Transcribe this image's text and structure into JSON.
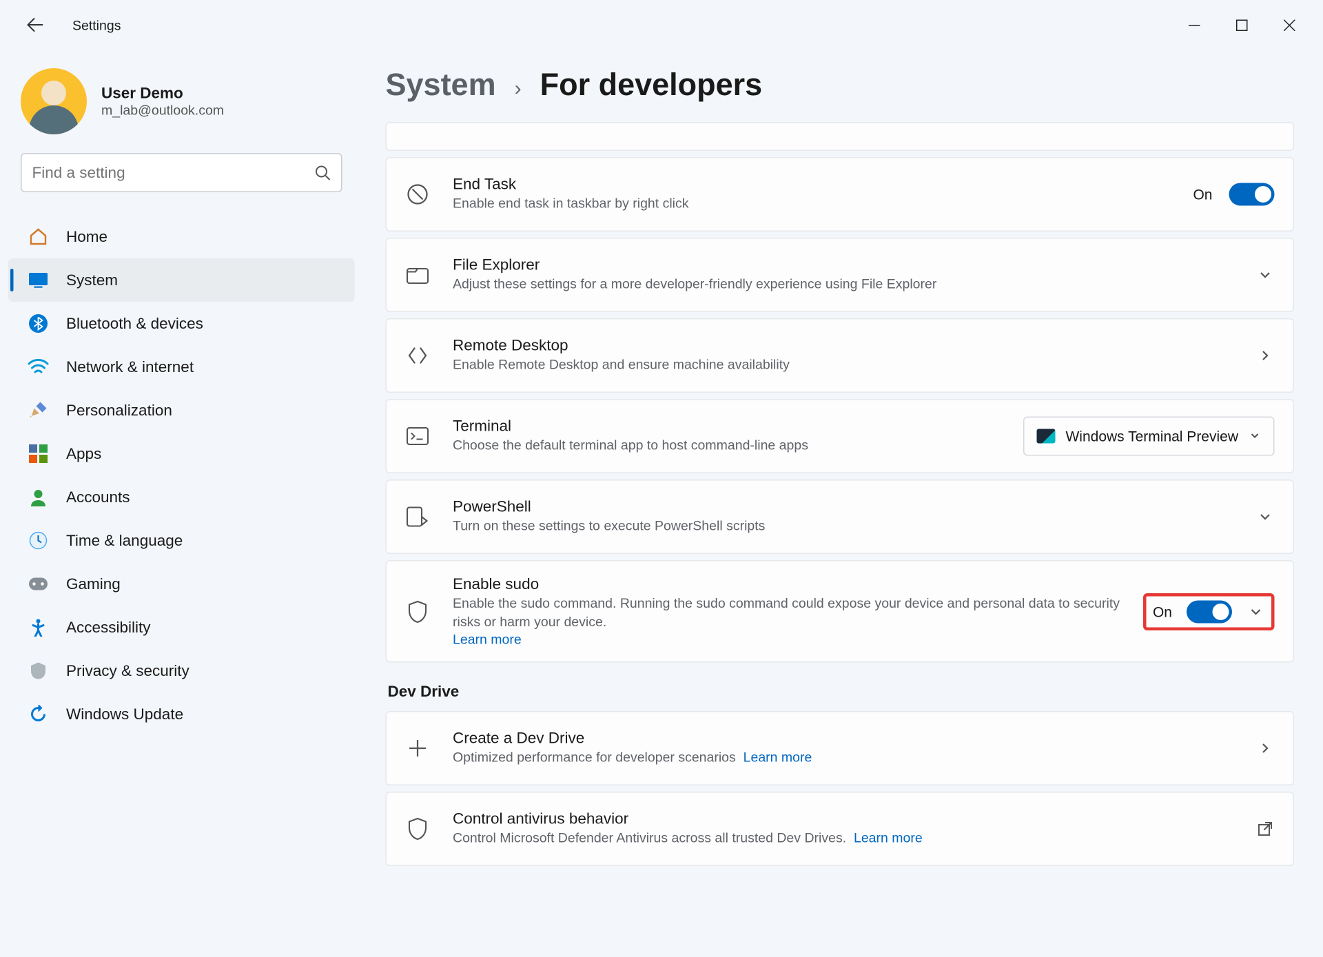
{
  "app": {
    "title": "Settings"
  },
  "user": {
    "name": "User Demo",
    "email": "m_lab@outlook.com"
  },
  "search": {
    "placeholder": "Find a setting"
  },
  "nav": {
    "home": "Home",
    "system": "System",
    "bluetooth": "Bluetooth & devices",
    "network": "Network & internet",
    "personalization": "Personalization",
    "apps": "Apps",
    "accounts": "Accounts",
    "time": "Time & language",
    "gaming": "Gaming",
    "accessibility": "Accessibility",
    "privacy": "Privacy & security",
    "update": "Windows Update"
  },
  "crumb": {
    "parent": "System",
    "sep": "›",
    "current": "For developers"
  },
  "cards": {
    "endTask": {
      "title": "End Task",
      "sub": "Enable end task in taskbar by right click",
      "state": "On"
    },
    "fileExplorer": {
      "title": "File Explorer",
      "sub": "Adjust these settings for a more developer-friendly experience using File Explorer"
    },
    "remoteDesktop": {
      "title": "Remote Desktop",
      "sub": "Enable Remote Desktop and ensure machine availability"
    },
    "terminal": {
      "title": "Terminal",
      "sub": "Choose the default terminal app to host command-line apps",
      "dropdown": "Windows Terminal Preview"
    },
    "powershell": {
      "title": "PowerShell",
      "sub": "Turn on these settings to execute PowerShell scripts"
    },
    "sudo": {
      "title": "Enable sudo",
      "sub": "Enable the sudo command. Running the sudo command could expose your device and personal data to security risks or harm your device.",
      "learn": "Learn more",
      "state": "On"
    }
  },
  "devDrive": {
    "header": "Dev Drive",
    "create": {
      "title": "Create a Dev Drive",
      "sub": "Optimized performance for developer scenarios",
      "learn": "Learn more"
    },
    "antivirus": {
      "title": "Control antivirus behavior",
      "sub": "Control Microsoft Defender Antivirus across all trusted Dev Drives.",
      "learn": "Learn more"
    }
  }
}
